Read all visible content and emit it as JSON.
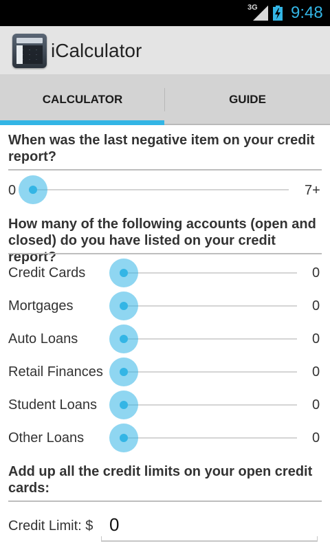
{
  "status_bar": {
    "network": "3G",
    "time": "9:48"
  },
  "app": {
    "title": "iCalculator",
    "icon": "calculator-app-icon"
  },
  "tabs": [
    {
      "label": "CALCULATOR",
      "selected": true
    },
    {
      "label": "GUIDE",
      "selected": false
    }
  ],
  "section_negative": {
    "question": "When was the last negative item on your credit report?",
    "min_label": "0",
    "max_label": "7+",
    "value_fraction": 0
  },
  "section_accounts": {
    "question": "How many of the following accounts (open and closed) do you have listed on your credit report?",
    "rows": [
      {
        "label": "Credit Cards",
        "value": "0"
      },
      {
        "label": "Mortgages",
        "value": "0"
      },
      {
        "label": "Auto Loans",
        "value": "0"
      },
      {
        "label": "Retail Finances",
        "value": "0"
      },
      {
        "label": "Student Loans",
        "value": "0"
      },
      {
        "label": "Other Loans",
        "value": "0"
      }
    ]
  },
  "section_limits": {
    "question": "Add up all the credit limits on your open credit cards:",
    "field_label": "Credit Limit: $",
    "field_value": "0"
  },
  "colors": {
    "accent": "#33b5e5",
    "tab_background": "#d3d3d3",
    "action_bar": "#e4e4e4"
  }
}
